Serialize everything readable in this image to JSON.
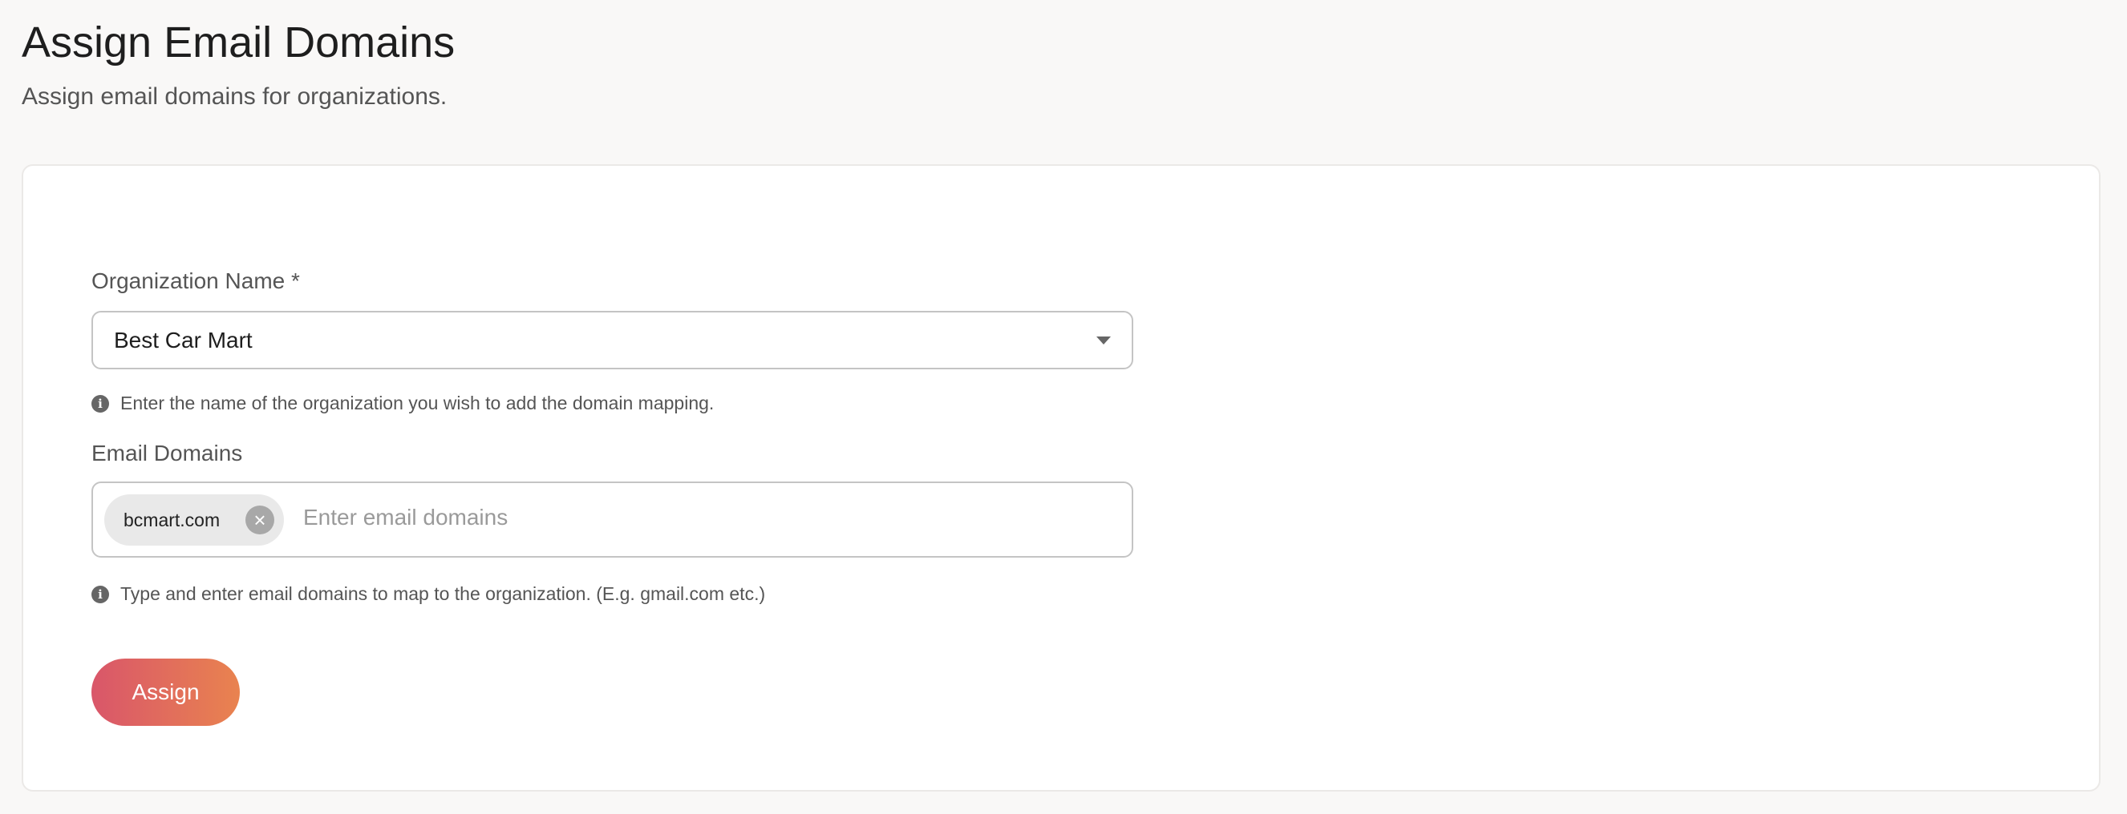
{
  "header": {
    "title": "Assign Email Domains",
    "subtitle": "Assign email domains for organizations."
  },
  "form": {
    "org_label": "Organization Name *",
    "org_value": "Best Car Mart",
    "org_help": "Enter the name of the organization you wish to add the domain mapping.",
    "domains_label": "Email Domains",
    "domains": [
      {
        "value": "bcmart.com"
      }
    ],
    "domains_placeholder": "Enter email domains",
    "domains_help": "Type and enter email domains to map to the organization. (E.g. gmail.com etc.)",
    "assign_label": "Assign"
  },
  "colors": {
    "button_gradient_start": "#d9566a",
    "button_gradient_end": "#e9834f"
  }
}
